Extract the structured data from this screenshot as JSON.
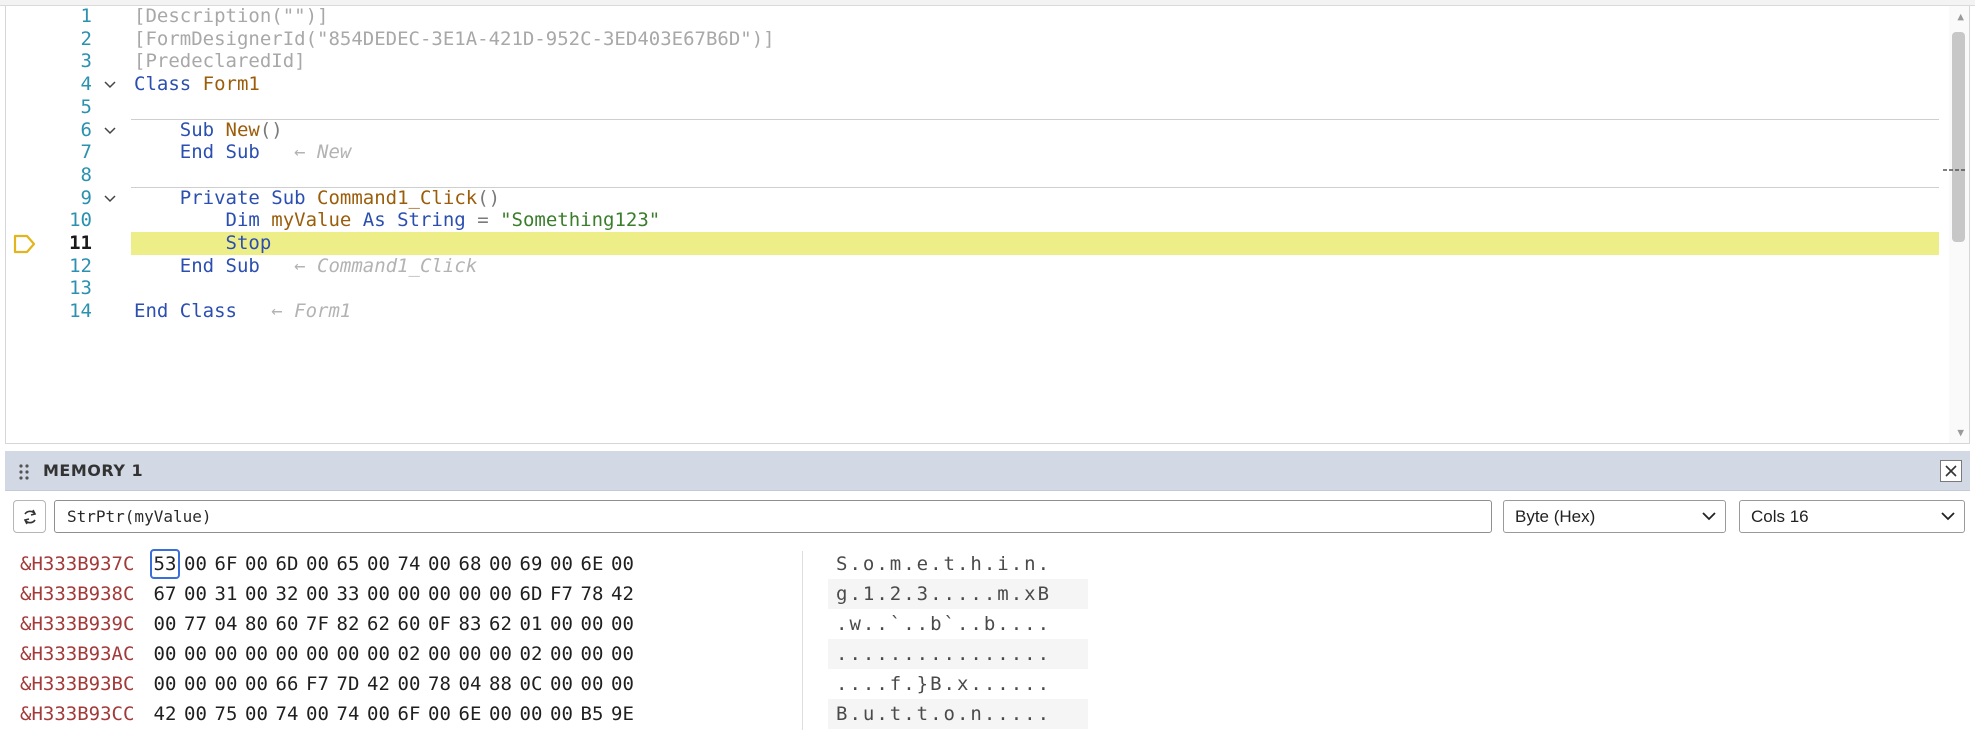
{
  "editor": {
    "lines": [
      {
        "n": "1",
        "tokens": [
          {
            "c": "attr",
            "t": "[Description(\"\")]"
          }
        ]
      },
      {
        "n": "2",
        "tokens": [
          {
            "c": "attr",
            "t": "[FormDesignerId(\"854DEDEC-3E1A-421D-952C-3ED403E67B6D\")]"
          }
        ]
      },
      {
        "n": "3",
        "tokens": [
          {
            "c": "attr",
            "t": "[PredeclaredId]"
          }
        ]
      },
      {
        "n": "4",
        "fold": true,
        "tokens": [
          {
            "c": "kw",
            "t": "Class "
          },
          {
            "c": "id",
            "t": "Form1"
          }
        ]
      },
      {
        "n": "5",
        "tokens": []
      },
      {
        "n": "6",
        "fold": true,
        "sep": true,
        "tokens": [
          {
            "c": "plain",
            "t": "    "
          },
          {
            "c": "kw",
            "t": "Sub "
          },
          {
            "c": "id",
            "t": "New"
          },
          {
            "c": "punc",
            "t": "()"
          }
        ]
      },
      {
        "n": "7",
        "tokens": [
          {
            "c": "plain",
            "t": "    "
          },
          {
            "c": "kw",
            "t": "End Sub"
          },
          {
            "c": "arr",
            "t": "   ← "
          },
          {
            "c": "anno",
            "t": "New"
          }
        ]
      },
      {
        "n": "8",
        "tokens": []
      },
      {
        "n": "9",
        "fold": true,
        "sep": true,
        "tokens": [
          {
            "c": "plain",
            "t": "    "
          },
          {
            "c": "kw",
            "t": "Private Sub "
          },
          {
            "c": "id",
            "t": "Command1_Click"
          },
          {
            "c": "punc",
            "t": "()"
          }
        ]
      },
      {
        "n": "10",
        "tokens": [
          {
            "c": "plain",
            "t": "        "
          },
          {
            "c": "kw",
            "t": "Dim "
          },
          {
            "c": "id",
            "t": "myValue "
          },
          {
            "c": "kw",
            "t": "As String"
          },
          {
            "c": "punc",
            "t": " = "
          },
          {
            "c": "str",
            "t": "\"Something123\""
          }
        ]
      },
      {
        "n": "11",
        "current": true,
        "tokens": [
          {
            "c": "plain",
            "t": "        "
          },
          {
            "c": "kw",
            "t": "Stop"
          }
        ]
      },
      {
        "n": "12",
        "tokens": [
          {
            "c": "plain",
            "t": "    "
          },
          {
            "c": "kw",
            "t": "End Sub"
          },
          {
            "c": "arr",
            "t": "   ← "
          },
          {
            "c": "anno",
            "t": "Command1_Click"
          }
        ]
      },
      {
        "n": "13",
        "tokens": []
      },
      {
        "n": "14",
        "tokens": [
          {
            "c": "kw",
            "t": "End Class"
          },
          {
            "c": "arr",
            "t": "   ← "
          },
          {
            "c": "anno",
            "t": "Form1"
          }
        ]
      }
    ]
  },
  "memory": {
    "title": "MEMORY 1",
    "address_expression": "StrPtr(myValue)",
    "format_selected": "Byte (Hex)",
    "cols_selected": "Cols 16",
    "selected_byte": {
      "row": 0,
      "col": 0
    },
    "rows": [
      {
        "addr": "&H333B937C",
        "bytes": [
          "53",
          "00",
          "6F",
          "00",
          "6D",
          "00",
          "65",
          "00",
          "74",
          "00",
          "68",
          "00",
          "69",
          "00",
          "6E",
          "00"
        ],
        "ascii": "S.o.m.e.t.h.i.n."
      },
      {
        "addr": "&H333B938C",
        "bytes": [
          "67",
          "00",
          "31",
          "00",
          "32",
          "00",
          "33",
          "00",
          "00",
          "00",
          "00",
          "00",
          "6D",
          "F7",
          "78",
          "42"
        ],
        "ascii": "g.1.2.3.....m.xB"
      },
      {
        "addr": "&H333B939C",
        "bytes": [
          "00",
          "77",
          "04",
          "80",
          "60",
          "7F",
          "82",
          "62",
          "60",
          "0F",
          "83",
          "62",
          "01",
          "00",
          "00",
          "00"
        ],
        "ascii": ".w..`..b`..b...."
      },
      {
        "addr": "&H333B93AC",
        "bytes": [
          "00",
          "00",
          "00",
          "00",
          "00",
          "00",
          "00",
          "00",
          "02",
          "00",
          "00",
          "00",
          "02",
          "00",
          "00",
          "00"
        ],
        "ascii": "................"
      },
      {
        "addr": "&H333B93BC",
        "bytes": [
          "00",
          "00",
          "00",
          "00",
          "66",
          "F7",
          "7D",
          "42",
          "00",
          "78",
          "04",
          "88",
          "0C",
          "00",
          "00",
          "00"
        ],
        "ascii": "....f.}B.x......"
      },
      {
        "addr": "&H333B93CC",
        "bytes": [
          "42",
          "00",
          "75",
          "00",
          "74",
          "00",
          "74",
          "00",
          "6F",
          "00",
          "6E",
          "00",
          "00",
          "00",
          "B5",
          "9E"
        ],
        "ascii": "B.u.t.t.o.n....."
      }
    ]
  },
  "colors": {
    "current_line_highlight": "#eeee88",
    "keyword": "#2b4fb0",
    "identifier": "#9b5d0a",
    "address": "#a33a3a",
    "selection_border": "#3b6fd8",
    "panel_header": "#d2d9e5"
  },
  "icons": {
    "breakpoint": "current-execution-arrow-icon",
    "fold": "chevron-down-icon",
    "refresh": "refresh-icon",
    "close": "close-icon",
    "grip": "drag-grip-icon"
  }
}
